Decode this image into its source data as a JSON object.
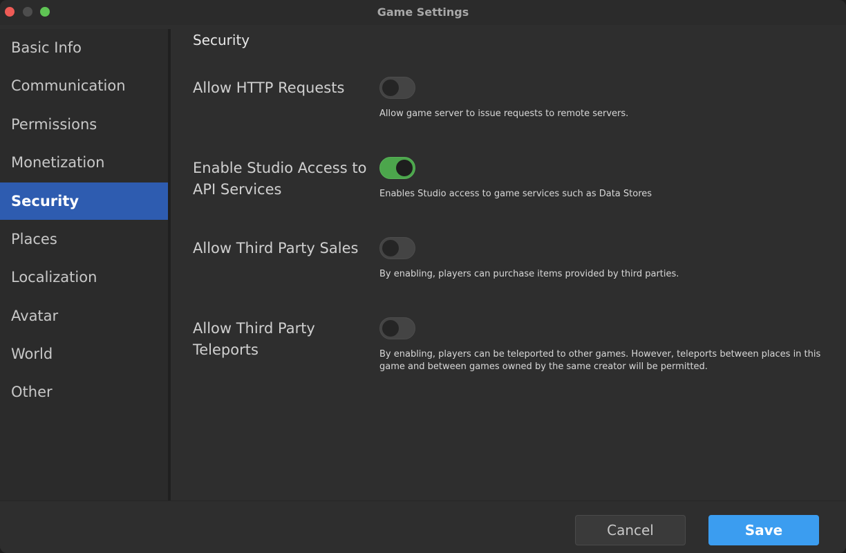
{
  "window": {
    "title": "Game Settings"
  },
  "sidebar": {
    "items": [
      {
        "label": "Basic Info"
      },
      {
        "label": "Communication"
      },
      {
        "label": "Permissions"
      },
      {
        "label": "Monetization"
      },
      {
        "label": "Security",
        "selected": true
      },
      {
        "label": "Places"
      },
      {
        "label": "Localization"
      },
      {
        "label": "Avatar"
      },
      {
        "label": "World"
      },
      {
        "label": "Other"
      }
    ]
  },
  "main": {
    "section_title": "Security",
    "settings": [
      {
        "label": "Allow HTTP Requests",
        "enabled": false,
        "description": "Allow game server to issue requests to remote servers."
      },
      {
        "label": "Enable Studio Access to API Services",
        "enabled": true,
        "description": "Enables Studio access to game services such as Data Stores"
      },
      {
        "label": "Allow Third Party Sales",
        "enabled": false,
        "description": "By enabling, players can purchase items provided by third parties."
      },
      {
        "label": "Allow Third Party Teleports",
        "enabled": false,
        "description": "By enabling, players can be teleported to other games. However, teleports between places in this game and between games owned by the same creator will be permitted."
      }
    ]
  },
  "footer": {
    "cancel_label": "Cancel",
    "save_label": "Save"
  },
  "colors": {
    "accent": "#3b9df0",
    "selection": "#2e5cb0",
    "toggle_on": "#4ca64c",
    "close": "#ee5b56",
    "maximize": "#5fc454"
  }
}
